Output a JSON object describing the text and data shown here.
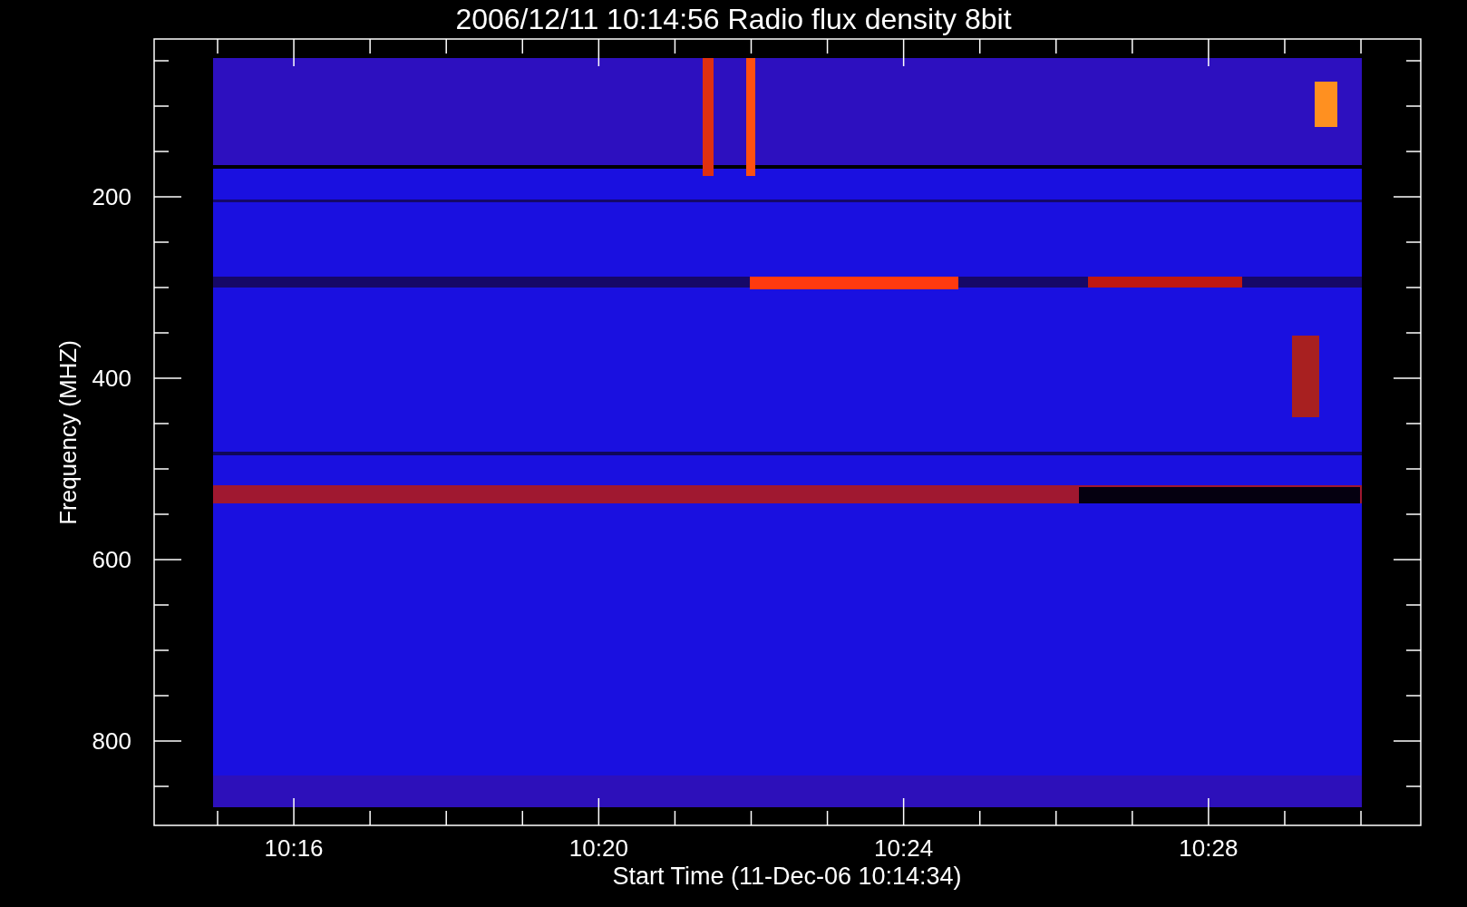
{
  "title": "2006/12/11 10:14:56 Radio flux density 8bit",
  "y_axis": {
    "label": "Frequency (MHZ)",
    "tick_labels": [
      "200",
      "400",
      "600",
      "800"
    ]
  },
  "x_axis": {
    "label": "Start Time (11-Dec-06 10:14:34)",
    "tick_labels": [
      "10:16",
      "10:20",
      "10:24",
      "10:28"
    ]
  }
}
